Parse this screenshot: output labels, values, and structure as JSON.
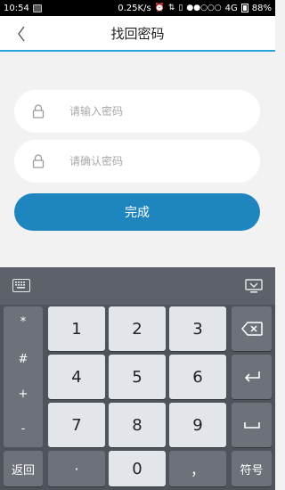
{
  "status_bar": {
    "time": "10:54",
    "speed": "0.25K/s",
    "signal": "●●○○○",
    "network": "4G",
    "battery": "88%"
  },
  "header": {
    "title": "找回密码",
    "back_glyph": "‹"
  },
  "form": {
    "password_placeholder": "请输入密码",
    "confirm_placeholder": "请确认密码",
    "submit_label": "完成"
  },
  "keyboard": {
    "left_keys": [
      "*",
      "#",
      "+",
      "-"
    ],
    "digit_rows": [
      [
        "1",
        "2",
        "3"
      ],
      [
        "4",
        "5",
        "6"
      ],
      [
        "7",
        "8",
        "9"
      ]
    ],
    "bottom_row": {
      "back": "返回",
      "dot": "·",
      "zero": "0",
      "comma": "，",
      "symbols": "符号"
    }
  }
}
